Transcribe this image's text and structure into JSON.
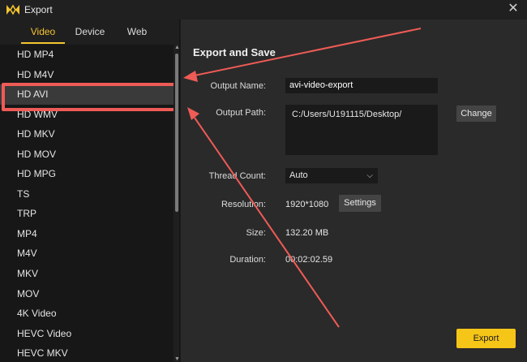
{
  "window": {
    "title": "Export",
    "close_glyph": "✕"
  },
  "tabs": [
    {
      "label": "Video",
      "active": true
    },
    {
      "label": "Device",
      "active": false
    },
    {
      "label": "Web",
      "active": false
    }
  ],
  "formats": [
    "HD MP4",
    "HD M4V",
    "HD AVI",
    "HD WMV",
    "HD MKV",
    "HD MOV",
    "HD MPG",
    "TS",
    "TRP",
    "MP4",
    "M4V",
    "MKV",
    "MOV",
    "4K Video",
    "HEVC Video",
    "HEVC MKV"
  ],
  "selected_format": "HD AVI",
  "panel": {
    "title": "Export and Save",
    "output_name_label": "Output Name:",
    "output_name_value": "avi-video-export",
    "output_path_label": "Output Path:",
    "output_path_value": "C:/Users/U191115/Desktop/",
    "change_label": "Change",
    "thread_count_label": "Thread Count:",
    "thread_count_value": "Auto",
    "resolution_label": "Resolution:",
    "resolution_value": "1920*1080",
    "settings_label": "Settings",
    "size_label": "Size:",
    "size_value": "132.20 MB",
    "duration_label": "Duration:",
    "duration_value": "00:02:02.59",
    "export_label": "Export"
  },
  "colors": {
    "accent": "#f4c430",
    "export_button": "#f5c518",
    "annotation": "#ef5b56"
  },
  "icons": {
    "logo": "filmora-logo-icon",
    "close": "close-icon",
    "dropdown": "chevron-down-icon"
  }
}
